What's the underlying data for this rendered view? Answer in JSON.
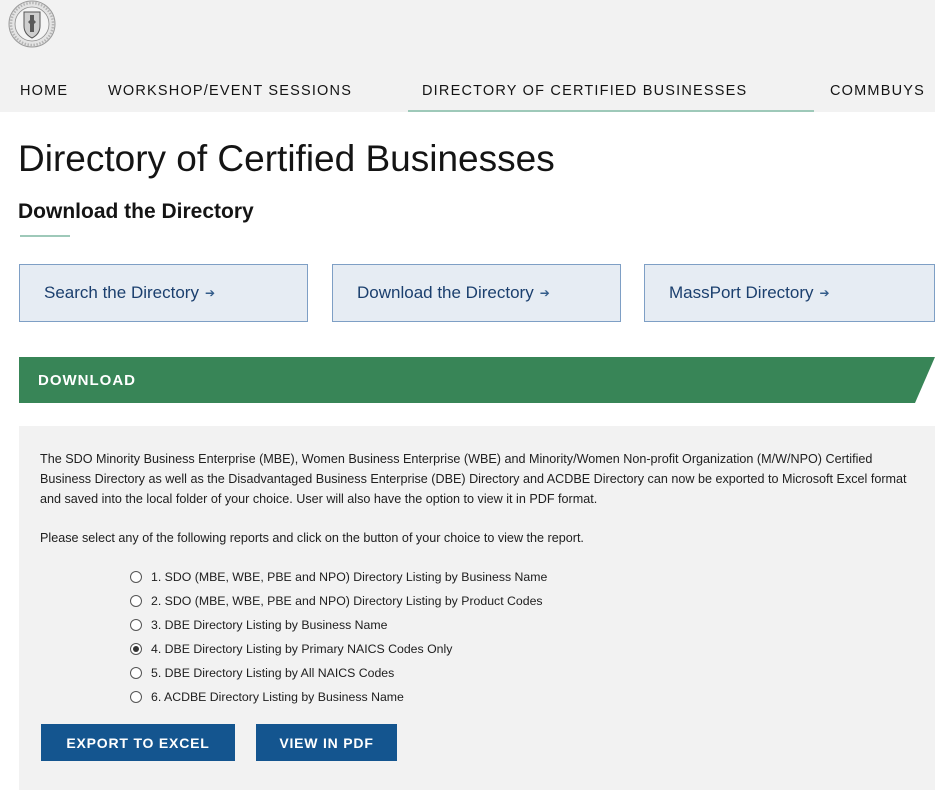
{
  "nav": {
    "items": [
      {
        "label": "HOME"
      },
      {
        "label": "WORKSHOP/EVENT SESSIONS"
      },
      {
        "label": "DIRECTORY OF CERTIFIED BUSINESSES"
      },
      {
        "label": "COMMBUYS"
      }
    ],
    "active": "DIRECTORY OF CERTIFIED BUSINESSES"
  },
  "page": {
    "title": "Directory of Certified Businesses",
    "subtitle": "Download the Directory"
  },
  "cards": [
    {
      "label": "Search the Directory",
      "arrow": "➔"
    },
    {
      "label": "Download the Directory",
      "arrow": "➔"
    },
    {
      "label": "MassPort Directory",
      "arrow": "➔"
    }
  ],
  "section": {
    "label": "DOWNLOAD",
    "color": "#388557"
  },
  "content": {
    "description": "The SDO Minority Business Enterprise (MBE), Women Business Enterprise (WBE) and Minority/Women Non-profit Organization (M/W/NPO) Certified Business Directory as well as the Disadvantaged Business Enterprise (DBE) Directory and ACDBE Directory can now be exported to Microsoft Excel format and saved into the local folder of your choice. User will also have the option to view it in PDF format.",
    "instruction": "Please select any of the following reports and click on the button of your choice to view the report.",
    "reports": [
      {
        "label": "1. SDO (MBE, WBE, PBE and NPO) Directory Listing by Business Name",
        "checked": false
      },
      {
        "label": "2. SDO (MBE, WBE, PBE and NPO) Directory Listing by Product Codes",
        "checked": false
      },
      {
        "label": "3. DBE Directory Listing by Business Name",
        "checked": false
      },
      {
        "label": "4. DBE Directory Listing by Primary NAICS Codes Only",
        "checked": true
      },
      {
        "label": "5. DBE Directory Listing by All NAICS Codes",
        "checked": false
      },
      {
        "label": "6. ACDBE Directory Listing by Business Name",
        "checked": false
      }
    ]
  },
  "buttons": {
    "export_label": "EXPORT TO EXCEL",
    "pdf_label": "VIEW IN PDF"
  },
  "colors": {
    "accent_green": "#388557",
    "button_blue": "#14558f",
    "card_bg": "#e6ecf3",
    "card_border": "#7e9fc5"
  }
}
